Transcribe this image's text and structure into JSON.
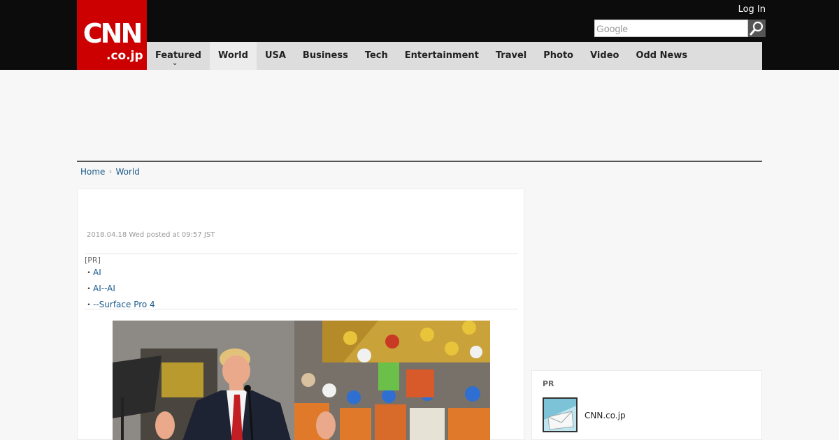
{
  "header": {
    "logo_main": "CNN",
    "logo_sub": ".co.jp",
    "login_label": "Log In",
    "search": {
      "placeholder": "Google",
      "button_icon": "magnifier-icon"
    },
    "brand_color": "#cc0000"
  },
  "nav": {
    "items": [
      {
        "label": "Featured",
        "has_dropdown": true
      },
      {
        "label": "World",
        "active": true
      },
      {
        "label": "USA"
      },
      {
        "label": "Business"
      },
      {
        "label": "Tech"
      },
      {
        "label": "Entertainment"
      },
      {
        "label": "Travel"
      },
      {
        "label": "Photo"
      },
      {
        "label": "Video"
      },
      {
        "label": "Odd News"
      }
    ]
  },
  "breadcrumb": {
    "home": "Home",
    "current": "World"
  },
  "article": {
    "posted": "2018.04.18 Wed posted at 09:57 JST",
    "pr": {
      "label": "[PR]",
      "links": [
        "AI",
        "AI--AI",
        "--Surface Pro 4"
      ]
    }
  },
  "sidebar": {
    "pr_label": "PR",
    "item_title": "CNN.co.jp"
  }
}
